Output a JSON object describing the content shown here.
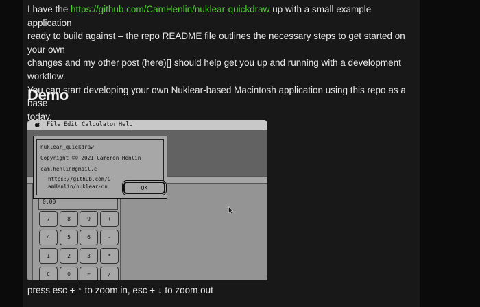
{
  "article": {
    "intro_before_link": "I have the ",
    "repo_link": "https://github.com/CamHenlin/nuklear-quickdraw",
    "intro_line1_after": " up with a small example application",
    "intro_line2": "ready to build against – the repo README file outlines the necessary steps to get started on your own",
    "intro_line3": "changes and my other post (here)[] should help get you up and running with a development workflow.",
    "intro_line4": "You can start developing your own Nuklear-based Macintosh application using this repo as a base",
    "intro_line5": "today.",
    "demo_heading": "Demo",
    "caption": "press esc + ↑ to zoom in, esc + ↓ to zoom out"
  },
  "mac_screen": {
    "menu": {
      "apple": "",
      "items": [
        "File",
        "Edit",
        "Calculator",
        "Help"
      ]
    },
    "about_dialog": {
      "line1": "nuklear_quickdraw",
      "line2": "Copyright ©© 2021 Cameron Henlin",
      "line3": "cam.henlin@gmail.c",
      "line4": "https://github.com/C",
      "line5": "amHenlin/nuklear-qu",
      "ok_label": "OK"
    },
    "calculator": {
      "display": "0.00",
      "keys": [
        "7",
        "8",
        "9",
        "+",
        "4",
        "5",
        "6",
        "-",
        "1",
        "2",
        "3",
        "*",
        "C",
        "0",
        "=",
        "/"
      ]
    }
  }
}
